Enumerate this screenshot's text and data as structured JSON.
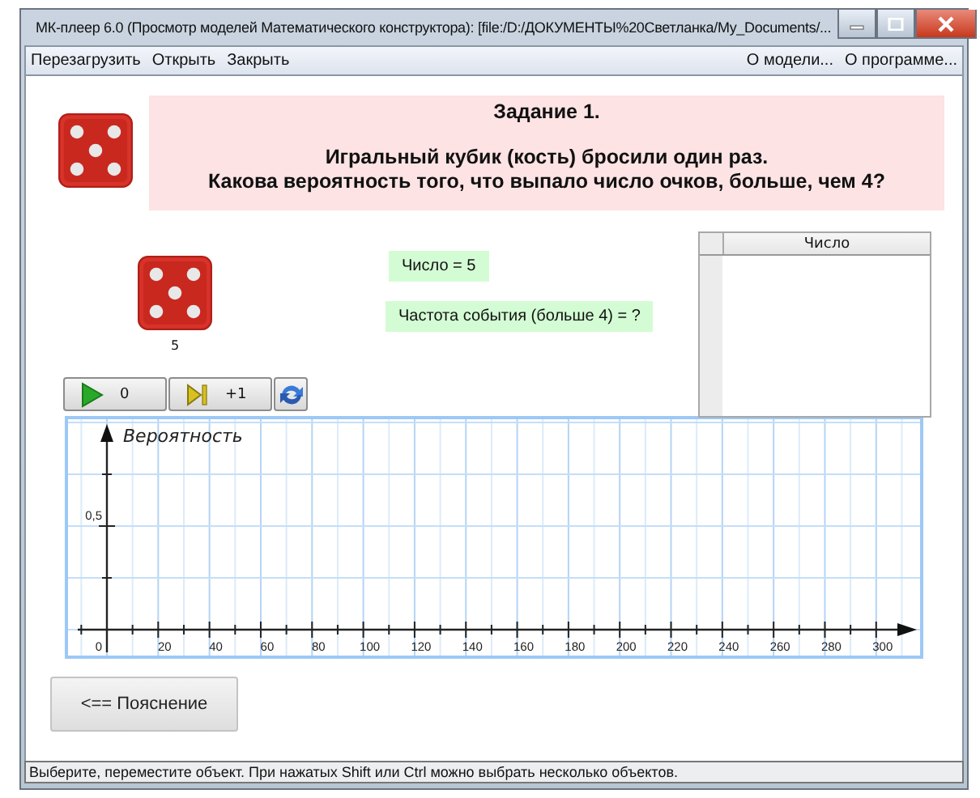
{
  "window": {
    "title": "МК-плеер 6.0 (Просмотр моделей Математического конструктора): [file:/D:/ДОКУМЕНТЫ%20Светланка/My_Documents/..."
  },
  "menu": {
    "left": [
      "Перезагрузить",
      "Открыть",
      "Закрыть"
    ],
    "right": [
      "О модели...",
      "О программе..."
    ]
  },
  "task": {
    "title": "Задание 1.",
    "lines": [
      "Игральный кубик (кость) бросили один раз.",
      "Какова вероятность того, что выпало число очков, больше, чем 4?"
    ]
  },
  "die": {
    "value": "5"
  },
  "fields": [
    "Число = 5",
    "Частота события (больше 4) = ?"
  ],
  "table": {
    "columns": [
      "Число"
    ]
  },
  "controls": [
    {
      "kind": "play",
      "label": "0"
    },
    {
      "kind": "step",
      "label": "+1"
    },
    {
      "kind": "refresh"
    }
  ],
  "graph": {
    "ylabel": "Вероятность",
    "ytick": "0,5",
    "xticks": [
      "0",
      "20",
      "40",
      "60",
      "80",
      "100",
      "120",
      "140",
      "160",
      "180",
      "200",
      "220",
      "240",
      "260",
      "280",
      "300"
    ]
  },
  "explain_button": "<== Пояснение",
  "status_bar": "Выберите, переместите объект. При нажатых Shift или Ctrl можно выбрать несколько объектов."
}
